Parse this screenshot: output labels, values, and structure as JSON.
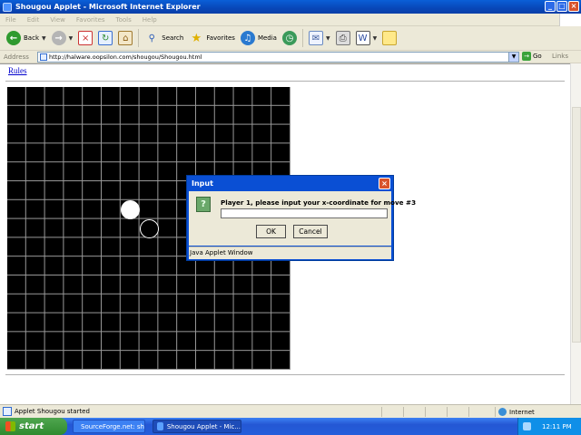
{
  "window": {
    "title": "Shougou Applet - Microsoft Internet Explorer",
    "controls": [
      "_",
      "□",
      "×"
    ]
  },
  "menu": [
    "File",
    "Edit",
    "View",
    "Favorites",
    "Tools",
    "Help"
  ],
  "toolbar": {
    "back_label": "Back",
    "search_label": "Search",
    "favorites_label": "Favorites",
    "media_label": "Media"
  },
  "address": {
    "label": "Address",
    "url": "http://halware.oopsilon.com/shougou/Shougou.html",
    "go_label": "Go",
    "links_label": "Links"
  },
  "page": {
    "rules_link": "Rules"
  },
  "board": {
    "grid_size": 15,
    "stones": [
      {
        "color": "white",
        "col": 6,
        "row": 6
      },
      {
        "color": "black",
        "col": 7,
        "row": 7
      }
    ]
  },
  "dialog": {
    "title": "Input",
    "prompt": "Player 1, please input your x-coordinate for move #3",
    "input_value": "",
    "ok_label": "OK",
    "cancel_label": "Cancel",
    "footer": "Java Applet Window"
  },
  "status": {
    "text": "Applet Shougou started",
    "zone": "Internet"
  },
  "taskbar": {
    "start_label": "start",
    "tasks": [
      "SourceForge.net: sh...",
      "Shougou Applet - Mic..."
    ],
    "clock": "12:11 PM"
  },
  "colors": {
    "title_bar": "#0a4fd4",
    "board": "#000000",
    "grid_line": "#9a9a9a",
    "link": "#0000cc",
    "taskbar": "#245edb"
  }
}
